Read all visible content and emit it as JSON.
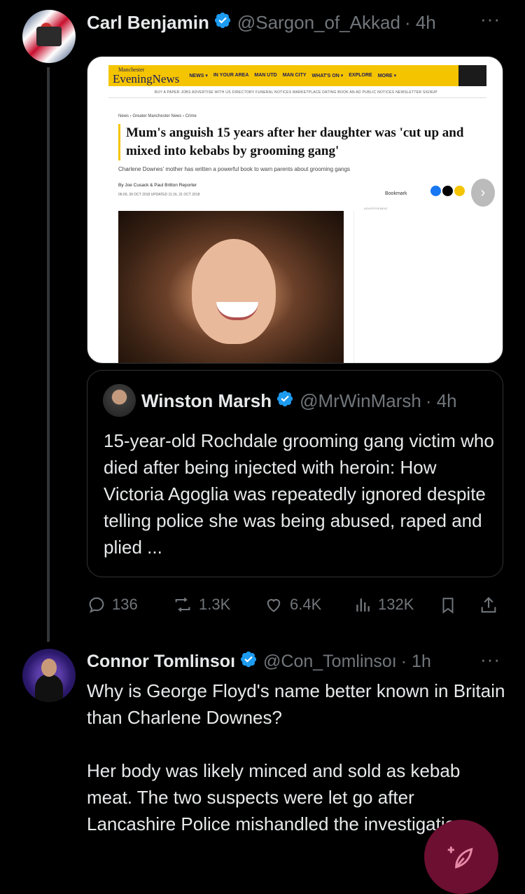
{
  "post1": {
    "display_name": "Carl Benjamin",
    "handle": "@Sargon_of_Akkad",
    "time": "· 4h",
    "card": {
      "site_logo_top": "Manchester",
      "site_logo": "EveningNews",
      "nav": [
        "NEWS ▾",
        "IN YOUR AREA",
        "MAN UTD",
        "MAN CITY",
        "WHAT'S ON ▾",
        "EXPLORE",
        "MORE ▾"
      ],
      "subnav": "BUY A PAPER   JOBS   ADVERTISE WITH US   DIRECTORY   FUNERAL NOTICES   MARKETPLACE   DATING   BOOK AN AD   PUBLIC NOTICES   NEWSLETTER SIGNUP",
      "breadcrumb": "News › Greater Manchester News › Crime",
      "headline": "Mum's anguish 15 years after her daughter was 'cut up and mixed into kebabs by grooming gang'",
      "standfirst": "Charlene Downes' mother has written a powerful book to warn parents about grooming gangs",
      "byline": "By Joe Cusack & Paul Britton Reporter",
      "dates": "06:00, 30 OCT 2018     UPDATED 11:16, 31 OCT 2018",
      "bookmark": "Bookmark",
      "advert": "ADVERTISEMENT"
    },
    "quote": {
      "display_name": "Winston Marsh",
      "handle": "@MrWinMarsh",
      "time": "· 4h",
      "text": "15-year-old Rochdale grooming gang victim who died after being injected with heroin: How Victoria Agoglia was repeatedly ignored despite telling police she was being abused, raped and plied ..."
    },
    "actions": {
      "replies": "136",
      "reposts": "1.3K",
      "likes": "6.4K",
      "views": "132K"
    }
  },
  "post2": {
    "display_name": "Connor Tomlinsoı",
    "handle": "@Con_Tomlinsoı",
    "time": "· 1h",
    "text_p1": "Why is George Floyd's name better known in Britain than Charlene Downes?",
    "text_p2": "Her body was likely minced and sold as kebab meat. The two suspects were let go after Lancashire Police mishandled the investigation."
  },
  "colors": {
    "background": "#000000",
    "text": "#e7e9ea",
    "muted": "#71767b",
    "verified": "#1d9bf0",
    "fab": "#6c0f31",
    "site_yellow": "#f5c400"
  },
  "icons": [
    "verified-badge-icon",
    "more-icon",
    "reply-icon",
    "repost-icon",
    "like-icon",
    "views-icon",
    "bookmark-icon",
    "share-icon",
    "compose-icon"
  ]
}
